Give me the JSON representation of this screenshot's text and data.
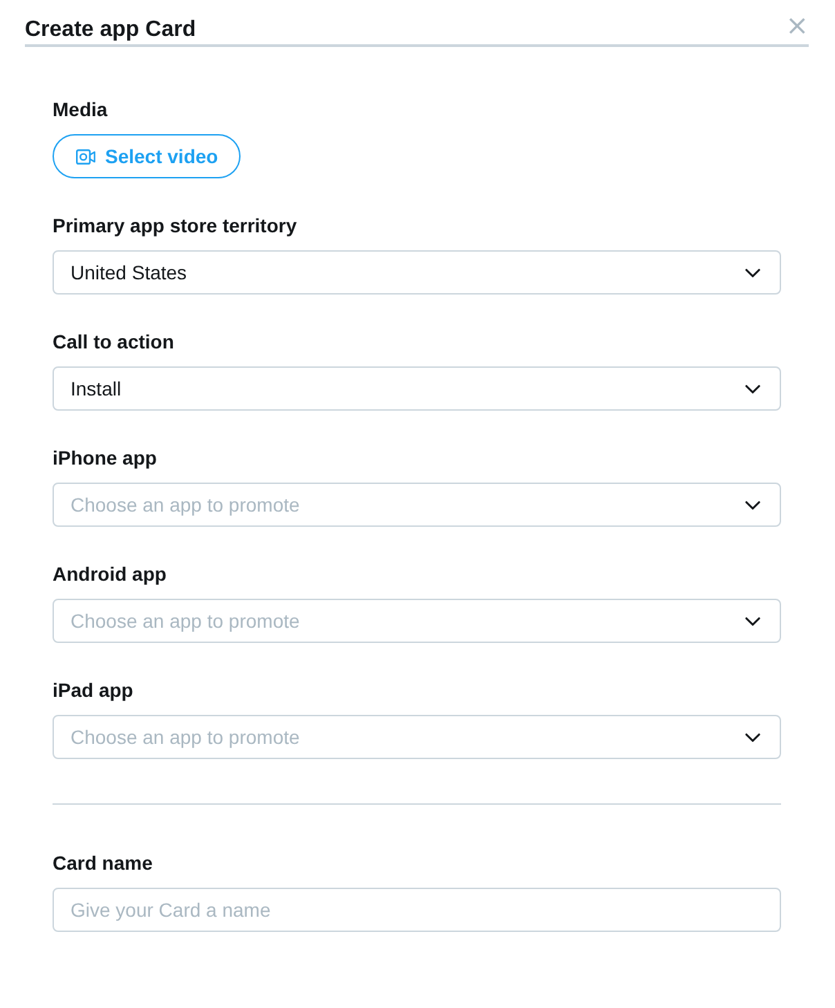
{
  "dialog": {
    "title": "Create app Card",
    "close": "×"
  },
  "sections": [
    {
      "fields": [
        {
          "kind": "media",
          "label": "Media",
          "button": "Select video"
        },
        {
          "kind": "select",
          "label": "Primary app store territory",
          "value": "United States"
        },
        {
          "kind": "select",
          "label": "Call to action",
          "value": "Install"
        },
        {
          "kind": "select",
          "label": "iPhone app",
          "placeholder": "Choose an app to promote"
        },
        {
          "kind": "select",
          "label": "Android app",
          "placeholder": "Choose an app to promote"
        },
        {
          "kind": "select",
          "label": "iPad app",
          "placeholder": "Choose an app to promote"
        }
      ]
    },
    {
      "fields": [
        {
          "kind": "text",
          "label": "Card name",
          "placeholder": "Give your Card a name"
        }
      ]
    }
  ]
}
